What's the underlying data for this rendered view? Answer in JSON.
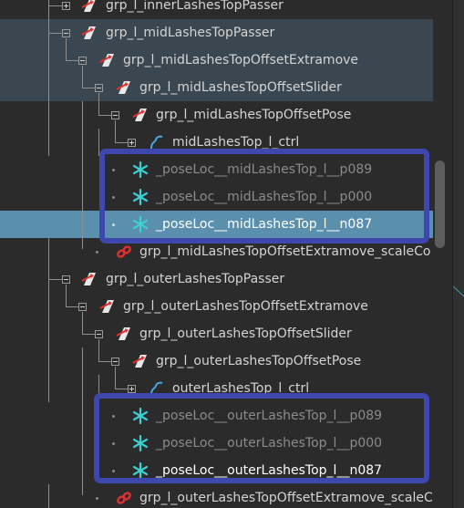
{
  "outliner": {
    "rows": [
      {
        "label": "grp_l_innerLashesTopPasser",
        "icon": "transform-icon",
        "state": "normal",
        "style": "normal"
      },
      {
        "label": "grp_l_midLashesTopPasser",
        "icon": "transform-icon",
        "state": "selected",
        "style": "normal"
      },
      {
        "label": "grp_l_midLashesTopOffsetExtramove",
        "icon": "transform-icon",
        "state": "selected",
        "style": "normal"
      },
      {
        "label": "grp_l_midLashesTopOffsetSlider",
        "icon": "transform-icon",
        "state": "selected",
        "style": "normal"
      },
      {
        "label": "grp_l_midLashesTopOffsetPose",
        "icon": "transform-icon",
        "state": "normal",
        "style": "normal"
      },
      {
        "label": "midLashesTop_l_ctrl",
        "icon": "curve-icon",
        "state": "normal",
        "style": "normal"
      },
      {
        "label": "_poseLoc__midLashesTop_l__p089",
        "icon": "locator-icon",
        "state": "normal",
        "style": "dim"
      },
      {
        "label": "_poseLoc__midLashesTop_l__p000",
        "icon": "locator-icon",
        "state": "normal",
        "style": "dim"
      },
      {
        "label": "_poseLoc__midLashesTop_l__n087",
        "icon": "locator-icon",
        "state": "active",
        "style": "bright"
      },
      {
        "label": "grp_l_midLashesTopOffsetExtramove_scaleCo",
        "icon": "constraint-icon",
        "state": "normal",
        "style": "normal"
      },
      {
        "label": "grp_l_outerLashesTopPasser",
        "icon": "transform-icon",
        "state": "normal",
        "style": "normal"
      },
      {
        "label": "grp_l_outerLashesTopOffsetExtramove",
        "icon": "transform-icon",
        "state": "normal",
        "style": "normal"
      },
      {
        "label": "grp_l_outerLashesTopOffsetSlider",
        "icon": "transform-icon",
        "state": "normal",
        "style": "normal"
      },
      {
        "label": "grp_l_outerLashesTopOffsetPose",
        "icon": "transform-icon",
        "state": "normal",
        "style": "normal"
      },
      {
        "label": "outerLashesTop_l_ctrl",
        "icon": "curve-icon",
        "state": "normal",
        "style": "normal"
      },
      {
        "label": "_poseLoc__outerLashesTop_l__p089",
        "icon": "locator-icon",
        "state": "normal",
        "style": "dim"
      },
      {
        "label": "_poseLoc__outerLashesTop_l__p000",
        "icon": "locator-icon",
        "state": "normal",
        "style": "dim"
      },
      {
        "label": "_poseLoc__outerLashesTop_l__n087",
        "icon": "locator-icon",
        "state": "normal",
        "style": "normal"
      },
      {
        "label": "grp_l_outerLashesTopOffsetExtramove_scaleCo",
        "icon": "constraint-icon",
        "state": "normal",
        "style": "normal"
      }
    ]
  },
  "colors": {
    "background": "#2b2b2b",
    "selected_row": "#3b4750",
    "active_row": "#5a8fae",
    "annotation_box": "#3d47ad",
    "locator": "#3dd0d0",
    "transform_arrow": "#e03030",
    "constraint": "#e03030",
    "curve": "#4aa8e8"
  }
}
